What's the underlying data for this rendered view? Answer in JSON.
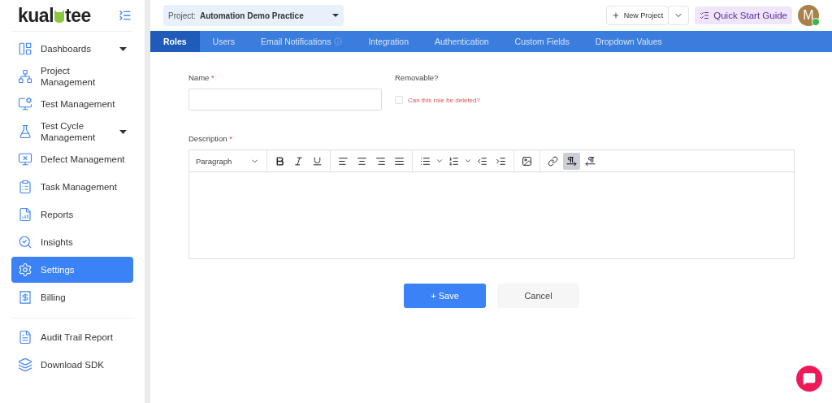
{
  "logo": {
    "left": "kual",
    "right": "tee"
  },
  "sidebar": {
    "items": [
      {
        "label": "Dashboards",
        "expandable": true,
        "selected": false
      },
      {
        "label": "Project Management",
        "expandable": false,
        "selected": false
      },
      {
        "label": "Test Management",
        "expandable": false,
        "selected": false
      },
      {
        "label": "Test Cycle Management",
        "expandable": true,
        "selected": false
      },
      {
        "label": "Defect Management",
        "expandable": false,
        "selected": false
      },
      {
        "label": "Task Management",
        "expandable": false,
        "selected": false
      },
      {
        "label": "Reports",
        "expandable": false,
        "selected": false
      },
      {
        "label": "Insights",
        "expandable": false,
        "selected": false
      },
      {
        "label": "Settings",
        "expandable": false,
        "selected": true
      },
      {
        "label": "Billing",
        "expandable": false,
        "selected": false
      }
    ],
    "footer_items": [
      {
        "label": "Audit Trail Report",
        "selected": false
      },
      {
        "label": "Download SDK",
        "selected": false
      }
    ]
  },
  "header": {
    "project_label": "Project:",
    "project_value": "Automation Demo Practice",
    "new_project": "New Project",
    "quick_start": "Quick Start Guide",
    "avatar": "M",
    "online": true
  },
  "tabs": [
    {
      "label": "Roles",
      "selected": true,
      "info": false
    },
    {
      "label": "Users",
      "selected": false,
      "info": false
    },
    {
      "label": "Email Notifications",
      "selected": false,
      "info": true
    },
    {
      "label": "Integration",
      "selected": false,
      "info": false
    },
    {
      "label": "Authentication",
      "selected": false,
      "info": false
    },
    {
      "label": "Custom Fields",
      "selected": false,
      "info": false
    },
    {
      "label": "Dropdown Values",
      "selected": false,
      "info": false
    }
  ],
  "form": {
    "name_label": "Name",
    "name_required": true,
    "removable_label": "Removable?",
    "removable_checkbox": "Can this role be deleted?",
    "removable_checked": false,
    "description_label": "Description",
    "description_required": true,
    "required_mark": "*",
    "editor": {
      "block_format": "Paragraph",
      "tool_groups": [
        [
          {
            "kind": "bold",
            "active": false
          },
          {
            "kind": "italic",
            "active": false
          },
          {
            "kind": "underline",
            "active": false
          }
        ],
        [
          {
            "kind": "align-left",
            "active": false
          },
          {
            "kind": "align-center",
            "active": false
          },
          {
            "kind": "align-right",
            "active": false
          },
          {
            "kind": "justify",
            "active": false
          }
        ],
        [
          {
            "kind": "bullets",
            "active": false
          },
          {
            "kind": "dropdown",
            "active": false
          },
          {
            "kind": "numbers",
            "active": false
          },
          {
            "kind": "dropdown",
            "active": false
          },
          {
            "kind": "outdent",
            "active": false
          },
          {
            "kind": "indent",
            "active": false
          }
        ],
        [
          {
            "kind": "image",
            "active": false
          }
        ],
        [
          {
            "kind": "link",
            "active": false
          },
          {
            "kind": "ltr",
            "active": true
          },
          {
            "kind": "rtl",
            "active": false
          }
        ]
      ]
    },
    "save": "+ Save",
    "cancel": "Cancel"
  }
}
